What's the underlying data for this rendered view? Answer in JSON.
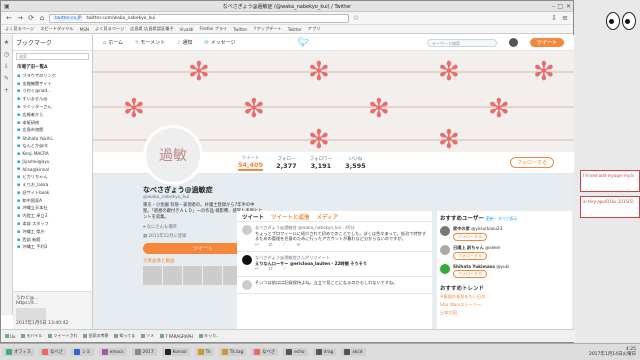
{
  "browser": {
    "title": "なべさぎょう@過敏症 (@waka_nabekyo_kui) / Twitter",
    "url_domain": "twitter.co.JP",
    "url": "twitter.com/waka_nabekyo_kui"
  },
  "bookmarks": [
    "よく見るページ",
    "スピードダイヤル",
    "MSN",
    "よく見るページ",
    "広島県 広島県認証電子",
    "Vivaldi",
    "Firefox プライ",
    "Twitter",
    "!!アップデート",
    "Twitter",
    "アプリ"
  ],
  "panel": {
    "title": "ブックマーク",
    "search": "検索",
    "folder": "市場デ旧一覧A",
    "items": [
      "ブラウザのリンク",
      "金融機関サイト",
      "うわぐ@nad...",
      "すいません@",
      "ツイッターさん",
      "広報者から",
      "本紙研修",
      "広島市旅館",
      "Shihata Yukihi...",
      "なんとか@nt",
      "Kenji MACRA",
      "Jiyamei@ayu",
      "Alisa@kinnal",
      "ヒカリちゃん",
      "えりお_lanka",
      "旧サイトbook",
      "和中国家A",
      "沖縄立天本社",
      "内陸工 卓立3",
      "本部 スタッフ",
      "沖縄工 県庁",
      "西部 新館",
      "沖縄工 手利3"
    ],
    "bottom_title": "うわぐ@...",
    "bottom_url": "https://t...",
    "bottom_date": "2017年1月5日 13:40:42"
  },
  "twitter": {
    "nav": [
      "ホーム",
      "モーメント",
      "通知",
      "メッセージ"
    ],
    "search": "キーワード検索",
    "tweet_btn": "ツイート",
    "stats": [
      {
        "label": "ツイート",
        "value": "54,409"
      },
      {
        "label": "フォロー",
        "value": "2,377"
      },
      {
        "label": "フォロワー",
        "value": "3,191"
      },
      {
        "label": "いいね",
        "value": "3,595"
      }
    ],
    "follow": "フォローする",
    "avatar_text": "過敏",
    "profile": {
      "name": "なべさぎょう@過敏症",
      "handle": "@waka_nabekyo_kui",
      "bio": "東京・小金園 有限・表現者の。弁護士登録から7年半の中堅。「感想の鍵付きＡＬＤ」一の作品 様影響、感覚と表現とヒントを収集。",
      "location": "なにさんも場所",
      "joined": "2011年12月に登録",
      "tweet": "ツイート",
      "photos": "写真画像と動画"
    },
    "tabs": [
      "ツイート",
      "ツイートと返信",
      "メディア"
    ],
    "tweets": [
      {
        "meta": "なべさぎょう@過敏症 @waka_nabekyo_kui · 40分",
        "text": "ちょっとプロフィールに紹介されて初めてのことでした。ぼくは色々あって。仮治で特許するための管理を任意のために行ったアカウントが暮れなど分からないのですが。"
      },
      {
        "meta": "なべさぎょう@過敏症さんがリツイート",
        "text": "えりなんローサー @ericlooa_lauten · 22時間 そうそう"
      },
      {
        "meta": "",
        "text": "そいつは前はは記録保持よね。立立で見ことになるのかもしれないですね。"
      }
    ],
    "who": {
      "title": "おすすめユーザー",
      "more": "更新・すべて表示",
      "users": [
        {
          "name": "家中の家",
          "handle": "@yosurkaou23",
          "btn": "フォローする"
        },
        {
          "name": "日陽上 訳ちゃん",
          "handle": "@sekei",
          "btn": "フォローする"
        },
        {
          "name": "Shihata Yukimasa",
          "handle": "@yuki",
          "btn": "フォローする"
        }
      ]
    },
    "trends": {
      "title": "おすすめトレンド",
      "items": [
        "#東国の意見をたい日の",
        "Star Warsストーリー",
        "日本の国"
      ]
    }
  },
  "status_tabs": [
    "Uu",
    "モバイル",
    "ツイートされ",
    "旧家の考察",
    "知ってま",
    "ソメ",
    "7 PARAGRAPH",
    "キッカ.."
  ],
  "taskbar": [
    "オフィス",
    "なべさ",
    "シミ",
    "emacs",
    "2017",
    "Konsol",
    "Tk",
    "Tk.tag",
    "なべさ",
    "echo",
    "drag",
    "xkcd"
  ],
  "clock": "4:25",
  "clock_date": "2017年1月14日火曜日",
  "notes": [
    "t-lnned-add-myagin-my.ls",
    "xl-tery-applQ16x 2015(5)"
  ]
}
